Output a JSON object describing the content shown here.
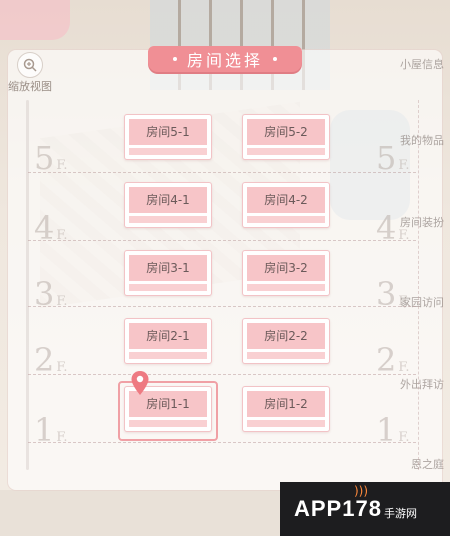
{
  "header": {
    "title": "房间选择"
  },
  "side_left": {
    "zoom_label": "缩放视图"
  },
  "side_right": {
    "items": [
      "小屋信息",
      "我的物品",
      "房间装扮",
      "家园访问",
      "外出拜访",
      "恩之庭"
    ]
  },
  "floors": [
    {
      "label": "5",
      "suffix": "F."
    },
    {
      "label": "4",
      "suffix": "F."
    },
    {
      "label": "3",
      "suffix": "F."
    },
    {
      "label": "2",
      "suffix": "F."
    },
    {
      "label": "1",
      "suffix": "F."
    }
  ],
  "rooms": [
    {
      "name": "房间5-1"
    },
    {
      "name": "房间5-2"
    },
    {
      "name": "房间4-1"
    },
    {
      "name": "房间4-2"
    },
    {
      "name": "房间3-1"
    },
    {
      "name": "房间3-2"
    },
    {
      "name": "房间2-1"
    },
    {
      "name": "房间2-2"
    },
    {
      "name": "房间1-1"
    },
    {
      "name": "房间1-2"
    }
  ],
  "selected_room": "房间1-1",
  "watermark": {
    "brand": "APP178",
    "sub": "手游网"
  },
  "colors": {
    "accent": "#f08f95",
    "room_band": "#f7c5c8",
    "room_border": "#f2c3c6"
  }
}
